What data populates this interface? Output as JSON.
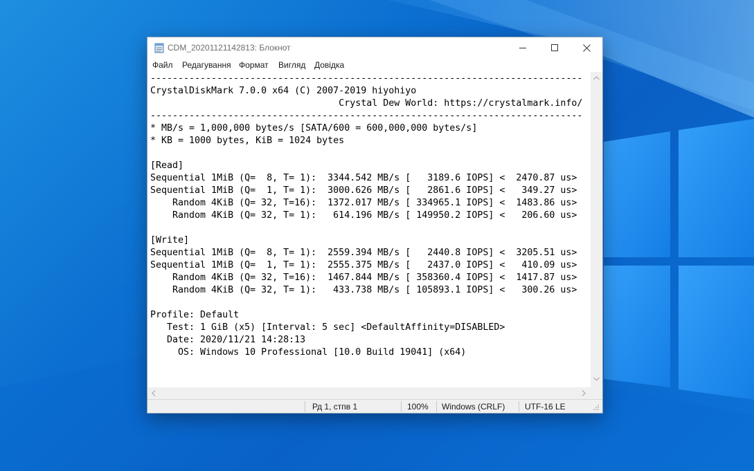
{
  "window": {
    "title": "CDM_20201121142813: Блокнот"
  },
  "menu": {
    "items": [
      "Файл",
      "Редагування",
      "Формат",
      "Вигляд",
      "Довідка"
    ]
  },
  "document": {
    "lines": [
      "------------------------------------------------------------------------------",
      "CrystalDiskMark 7.0.0 x64 (C) 2007-2019 hiyohiyo",
      "                                  Crystal Dew World: https://crystalmark.info/",
      "------------------------------------------------------------------------------",
      "* MB/s = 1,000,000 bytes/s [SATA/600 = 600,000,000 bytes/s]",
      "* KB = 1000 bytes, KiB = 1024 bytes",
      "",
      "[Read]",
      "Sequential 1MiB (Q=  8, T= 1):  3344.542 MB/s [   3189.6 IOPS] <  2470.87 us>",
      "Sequential 1MiB (Q=  1, T= 1):  3000.626 MB/s [   2861.6 IOPS] <   349.27 us>",
      "    Random 4KiB (Q= 32, T=16):  1372.017 MB/s [ 334965.1 IOPS] <  1483.86 us>",
      "    Random 4KiB (Q= 32, T= 1):   614.196 MB/s [ 149950.2 IOPS] <   206.60 us>",
      "",
      "[Write]",
      "Sequential 1MiB (Q=  8, T= 1):  2559.394 MB/s [   2440.8 IOPS] <  3205.51 us>",
      "Sequential 1MiB (Q=  1, T= 1):  2555.375 MB/s [   2437.0 IOPS] <   410.09 us>",
      "    Random 4KiB (Q= 32, T=16):  1467.844 MB/s [ 358360.4 IOPS] <  1417.87 us>",
      "    Random 4KiB (Q= 32, T= 1):   433.738 MB/s [ 105893.1 IOPS] <   300.26 us>",
      "",
      "Profile: Default",
      "   Test: 1 GiB (x5) [Interval: 5 sec] <DefaultAffinity=DISABLED>",
      "   Date: 2020/11/21 14:28:13",
      "     OS: Windows 10 Professional [10.0 Build 19041] (x64)"
    ]
  },
  "statusbar": {
    "position": "Рд 1, стпв 1",
    "zoom": "100%",
    "line_endings": "Windows (CRLF)",
    "encoding": "UTF-16 LE"
  },
  "icons": {
    "app": "notepad-icon",
    "minimize": "minimize-icon",
    "maximize": "maximize-icon",
    "close": "close-icon"
  },
  "colors": {
    "desktop_accent": "#0b6fd1",
    "window_bg": "#ffffff",
    "chrome_gray": "#f0f0f0"
  }
}
